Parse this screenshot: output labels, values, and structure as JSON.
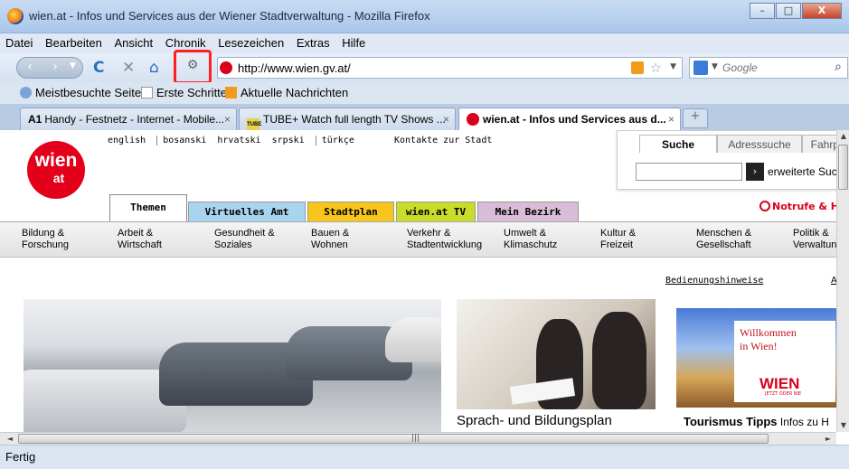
{
  "window": {
    "title": "wien.at - Infos und Services aus der Wiener Stadtverwaltung - Mozilla Firefox",
    "minimize": "–",
    "maximize": "□",
    "close": "X"
  },
  "menu": [
    "Datei",
    "Bearbeiten",
    "Ansicht",
    "Chronik",
    "Lesezeichen",
    "Extras",
    "Hilfe"
  ],
  "nav": {
    "back": "‹",
    "forward": "›",
    "dropdown": "▼",
    "reload": "C",
    "stop": "✕",
    "home": "⌂",
    "addon": "⚙",
    "url": "http://www.wien.gv.at/",
    "star": "☆",
    "url_dropdown": "▼",
    "search_placeholder": "Google",
    "search_dropdown": "▼",
    "search_go": "⌕"
  },
  "bookmarks": [
    "Meistbesuchte Seiten",
    "Erste Schritte",
    "Aktuelle Nachrichten"
  ],
  "tabs": [
    {
      "label": "Handy - Festnetz - Internet - Mobile...",
      "fav": "A1",
      "close": "×"
    },
    {
      "label": "TUBE+ Watch full length TV Shows ...",
      "fav": "TUBE",
      "close": "×"
    },
    {
      "label": "wien.at - Infos und Services aus d...",
      "close": "×"
    }
  ],
  "new_tab": "+",
  "page": {
    "logo_top": "wien",
    "logo_bottom": "at",
    "languages": [
      "english",
      "bosanski",
      "hrvatski",
      "srpski",
      "türkçe"
    ],
    "kontakte": "Kontakte zur Stadt",
    "search_tabs": [
      "Suche",
      "Adresssuche",
      "Fahrpla"
    ],
    "search_go": "›",
    "search_link": "erweiterte Such",
    "notrufe": "Notrufe & H",
    "main_tabs": [
      {
        "label": "Themen",
        "color": "#ffffff"
      },
      {
        "label": "Virtuelles Amt",
        "color": "#a8d4ef"
      },
      {
        "label": "Stadtplan",
        "color": "#f7c51b"
      },
      {
        "label": "wien.at TV",
        "color": "#c9dc2a"
      },
      {
        "label": "Mein Bezirk",
        "color": "#d9bcd6"
      }
    ],
    "categories": [
      "Bildung &\nForschung",
      "Arbeit &\nWirtschaft",
      "Gesundheit &\nSoziales",
      "Bauen &\nWohnen",
      "Verkehr &\nStadtentwicklung",
      "Umwelt &\nKlimaschutz",
      "Kultur &\nFreizeit",
      "Menschen &\nGesellschaft",
      "Politik &\nVerwaltun"
    ],
    "bedienung": "Bedienungshinweise",
    "bedienung_a": "A",
    "caption_sprach": "Sprach- und Bildungsplan",
    "tour_welcome": "Willkommen\nin Wien!",
    "tour_wien": "WIEN",
    "tour_jetzt": "JETZT ODER NIE",
    "tour_caption_bold": "Tourismus Tipps",
    "tour_caption_rest": " Infos zu H"
  },
  "scroll": {
    "up": "▲",
    "down": "▼",
    "left": "◄",
    "right": "►",
    "grip": "|||"
  },
  "status": "Fertig"
}
